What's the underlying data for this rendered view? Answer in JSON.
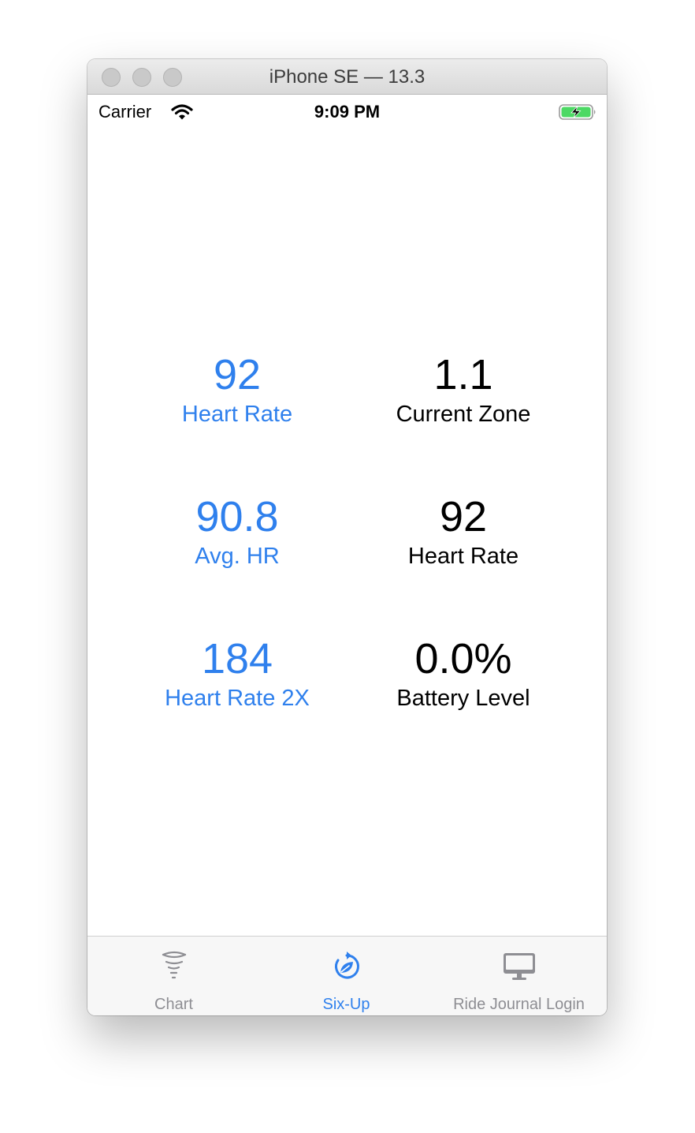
{
  "window": {
    "title": "iPhone SE — 13.3"
  },
  "status_bar": {
    "carrier": "Carrier",
    "time": "9:09 PM",
    "icons": [
      "wifi-icon",
      "battery-charging-icon"
    ]
  },
  "metrics": [
    {
      "value": "92",
      "label": "Heart Rate",
      "color": "#2f80ed"
    },
    {
      "value": "1.1",
      "label": "Current Zone",
      "color": "#000000"
    },
    {
      "value": "90.8",
      "label": "Avg. HR",
      "color": "#2f80ed"
    },
    {
      "value": "92",
      "label": "Heart Rate",
      "color": "#000000"
    },
    {
      "value": "184",
      "label": "Heart Rate 2X",
      "color": "#2f80ed"
    },
    {
      "value": "0.0%",
      "label": "Battery Level",
      "color": "#000000"
    }
  ],
  "tab_bar": {
    "tabs": [
      {
        "label": "Chart",
        "icon": "tornado-icon",
        "active": false
      },
      {
        "label": "Six-Up",
        "icon": "refresh-leaf-icon",
        "active": true
      },
      {
        "label": "Ride Journal Login",
        "icon": "desktop-icon",
        "active": false
      }
    ]
  },
  "colors": {
    "accent": "#2f80ed",
    "inactive_tab": "#8e8e93",
    "battery_green": "#4cd964"
  }
}
